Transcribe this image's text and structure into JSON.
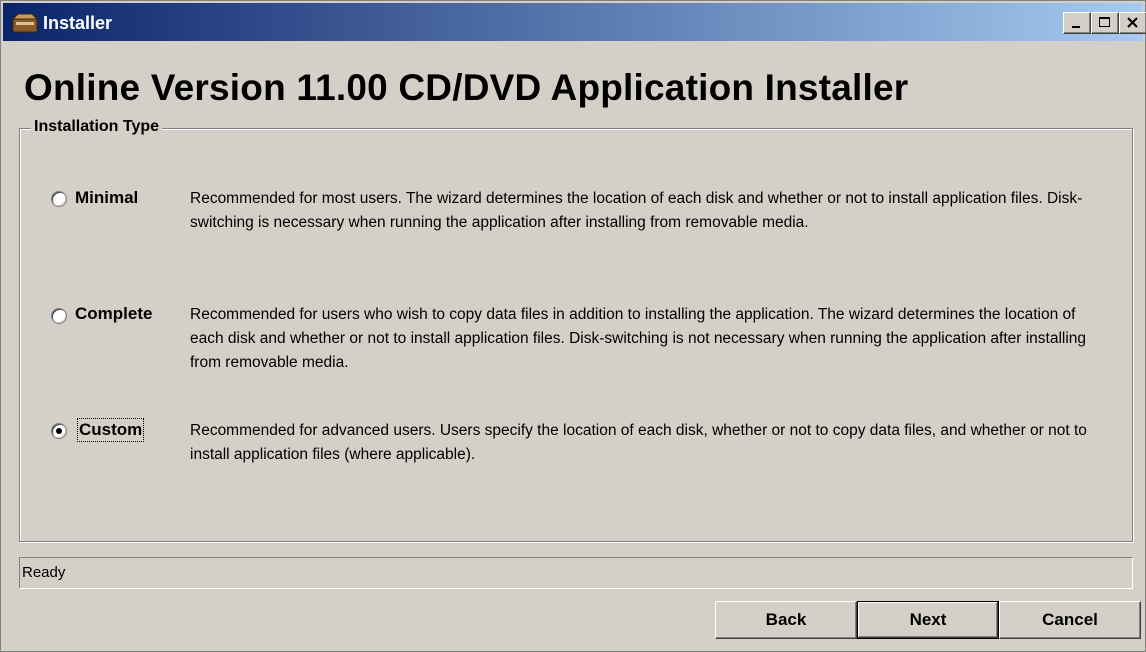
{
  "window": {
    "title": "Installer",
    "icon": "installer-box-icon",
    "controls": [
      "minimize-icon",
      "maximize-icon",
      "close-icon"
    ]
  },
  "main": {
    "heading": "Online Version 11.00 CD/DVD Application Installer"
  },
  "installation_type": {
    "group_label": "Installation Type",
    "options": [
      {
        "label": "Minimal",
        "selected": false,
        "description": "Recommended for most users.  The wizard determines the location of each disk and whether or not to install application files.  Disk-switching is necessary when running the application after installing from removable media."
      },
      {
        "label": "Complete",
        "selected": false,
        "description": "Recommended for users who wish to copy data files in addition to installing the application.  The wizard determines the location of each disk and whether or not to install application files.  Disk-switching is not necessary when running the application after installing from removable media."
      },
      {
        "label": "Custom",
        "selected": true,
        "description": "Recommended for advanced users.  Users specify the location of each disk, whether or not to copy data files, and whether or not to install application files (where applicable)."
      }
    ]
  },
  "status": {
    "text": "Ready"
  },
  "buttons": {
    "back": "Back",
    "next": "Next",
    "cancel": "Cancel"
  },
  "colors": {
    "titlebar_start": "#0a246a",
    "titlebar_end": "#a6caf0",
    "face": "#d4d0c8"
  }
}
